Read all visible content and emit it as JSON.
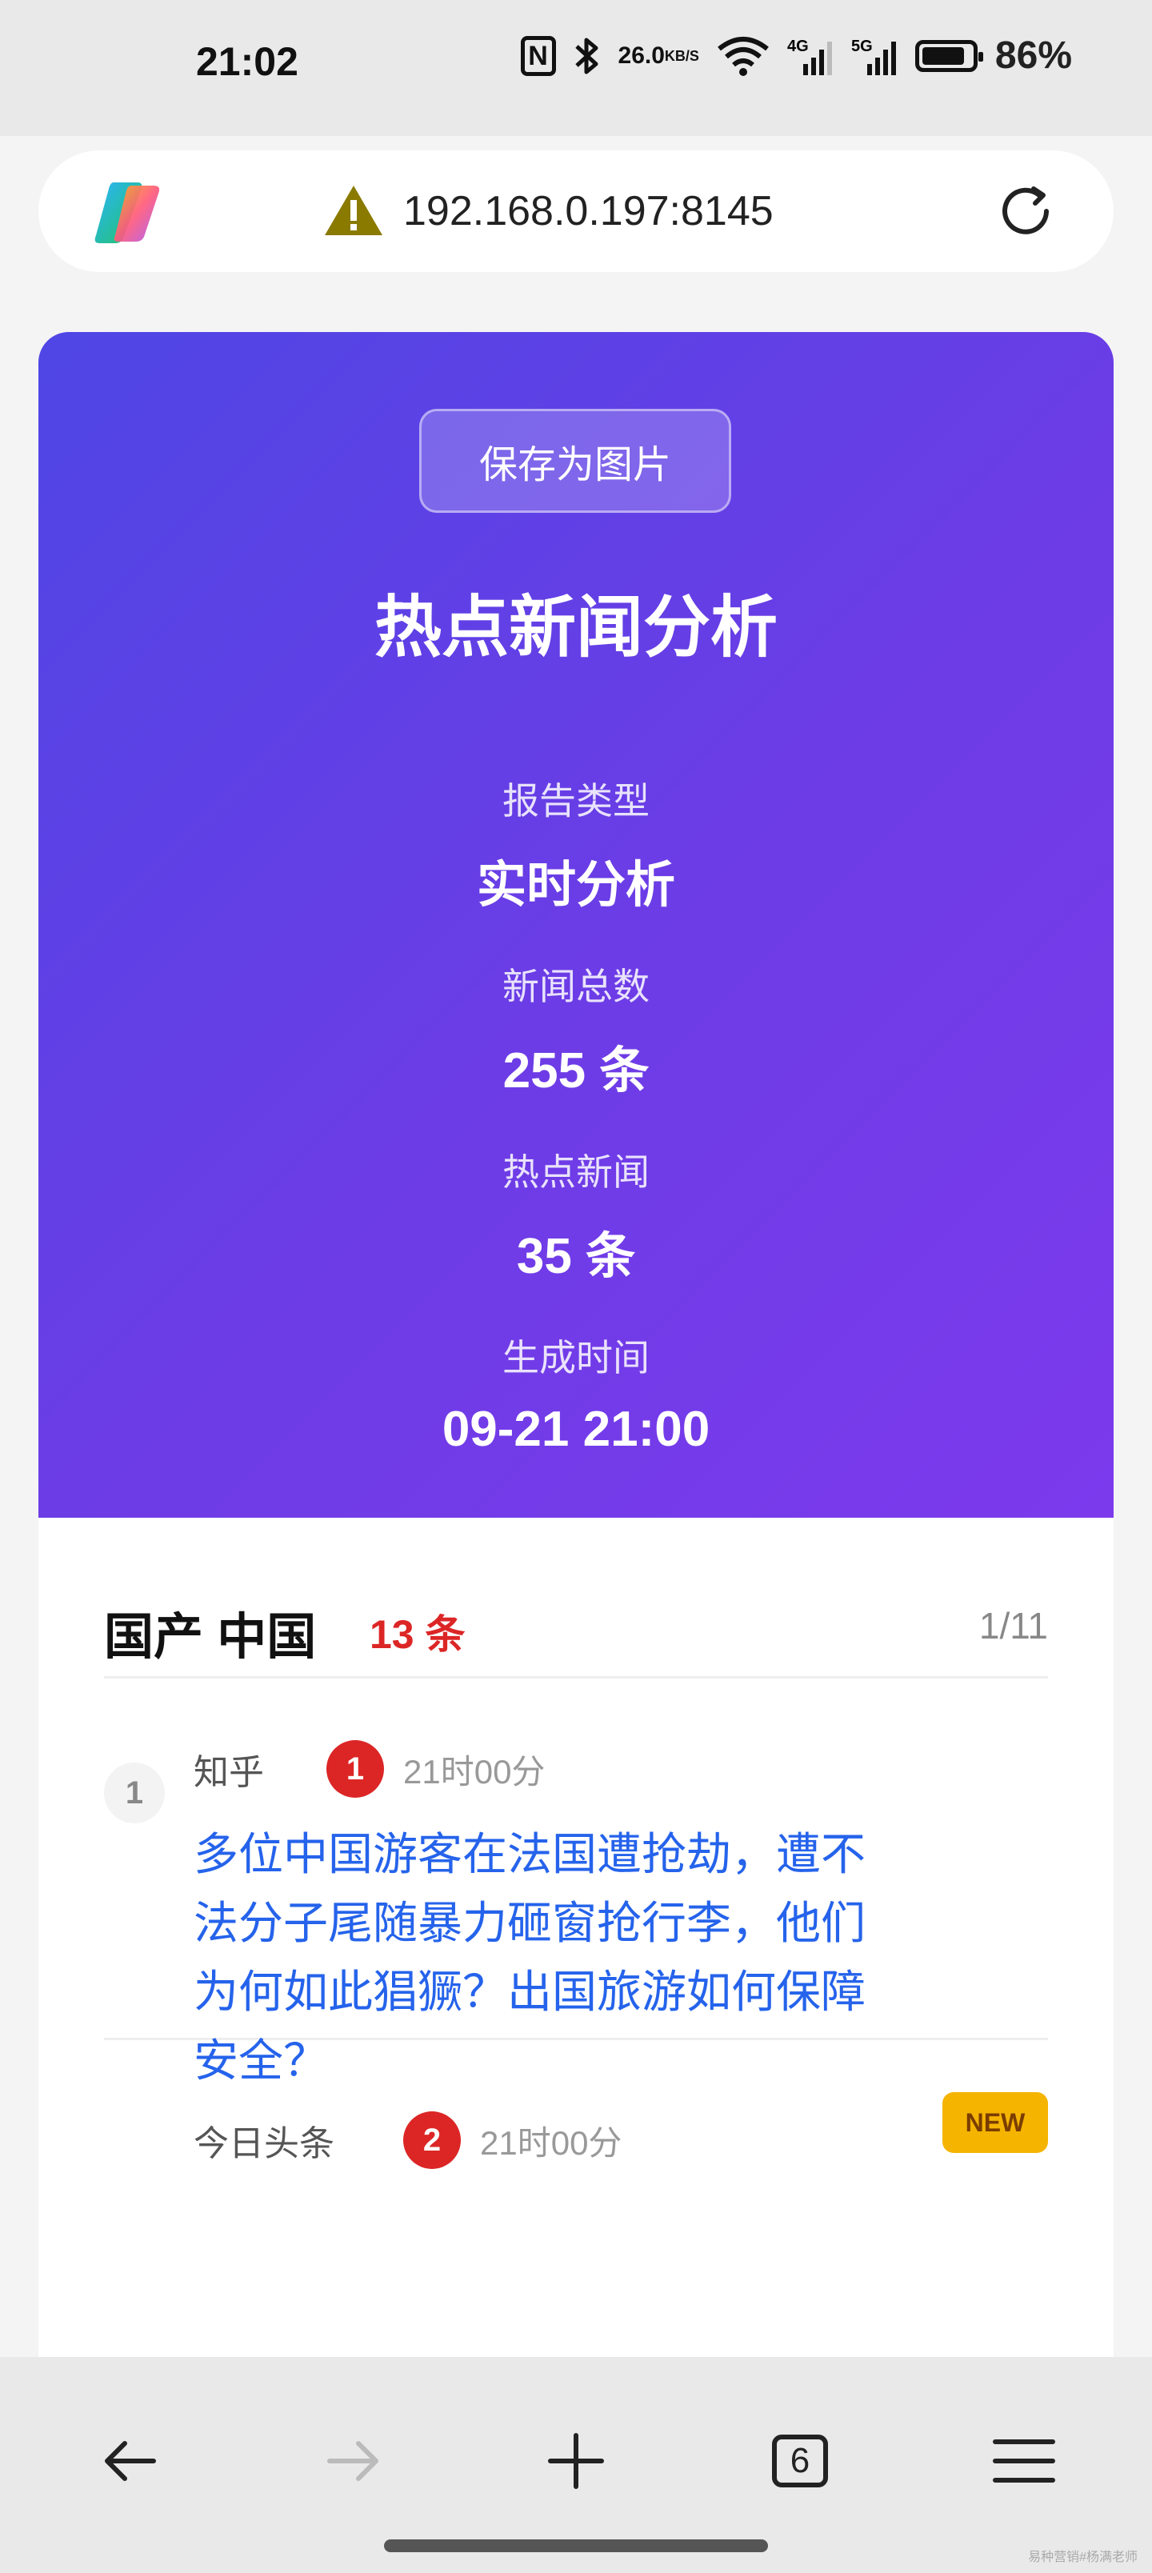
{
  "status_bar": {
    "time": "21:02",
    "net_speed_value": "26.0",
    "net_speed_unit": "KB/S",
    "signal_4g": "4G",
    "signal_5g": "5G",
    "battery_percent": "86%",
    "battery_level": 0.86
  },
  "browser": {
    "url": "192.168.0.197:8145",
    "open_tabs": "6"
  },
  "hero": {
    "save_button": "保存为图片",
    "title": "热点新闻分析",
    "stats": [
      {
        "label": "报告类型",
        "value": "实时分析"
      },
      {
        "label": "新闻总数",
        "value": "255 条"
      },
      {
        "label": "热点新闻",
        "value": "35 条"
      },
      {
        "label": "生成时间",
        "value": "09-21 21:00"
      }
    ]
  },
  "section": {
    "title": "国产 中国",
    "count": "13 条",
    "page": "1/11"
  },
  "news": [
    {
      "index": "1",
      "source": "知乎",
      "rank": "1",
      "time": "21时00分",
      "title": "多位中国游客在法国遭抢劫，遭不法分子尾随暴力砸窗抢行李，他们为何如此猖獗？出国旅游如何保障安全？"
    },
    {
      "source": "今日头条",
      "rank": "2",
      "time": "21时00分",
      "badge": "NEW"
    }
  ],
  "watermark": "易种营销#杨满老师"
}
